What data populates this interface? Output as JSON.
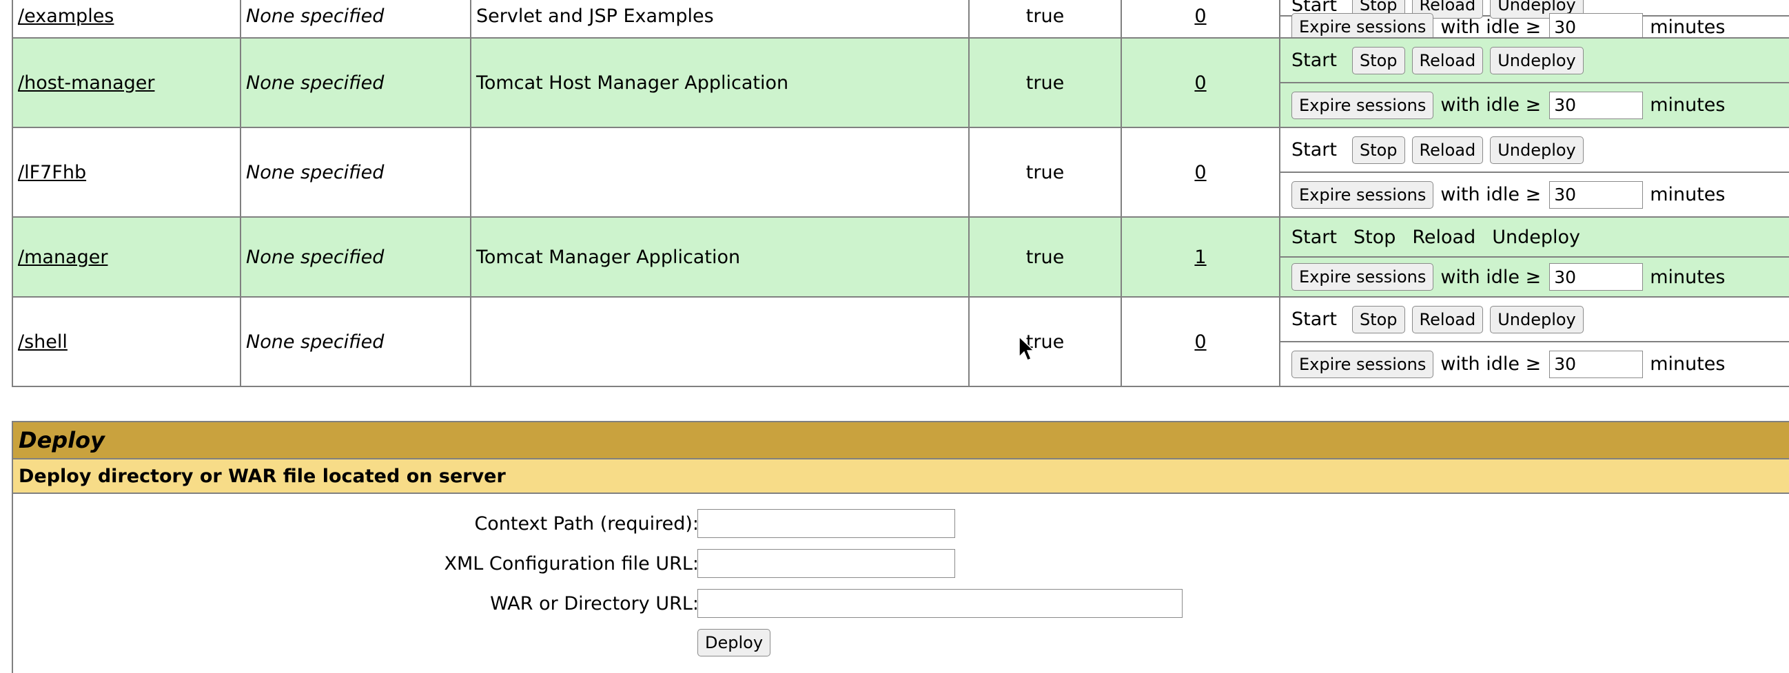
{
  "apps": [
    {
      "path": "/examples",
      "version": "None specified",
      "display": "Servlet and JSP Examples",
      "running": "true",
      "sessions": "0",
      "commands_are_links": false
    },
    {
      "path": "/host-manager",
      "version": "None specified",
      "display": "Tomcat Host Manager Application",
      "running": "true",
      "sessions": "0",
      "commands_are_links": false
    },
    {
      "path": "/lF7Fhb",
      "version": "None specified",
      "display": "",
      "running": "true",
      "sessions": "0",
      "commands_are_links": false
    },
    {
      "path": "/manager",
      "version": "None specified",
      "display": "Tomcat Manager Application",
      "running": "true",
      "sessions": "1",
      "commands_are_links": true
    },
    {
      "path": "/shell",
      "version": "None specified",
      "display": "",
      "running": "true",
      "sessions": "0",
      "commands_are_links": false
    }
  ],
  "commands": {
    "start": "Start",
    "stop": "Stop",
    "reload": "Reload",
    "undeploy": "Undeploy"
  },
  "expire": {
    "button": "Expire sessions",
    "with_idle": "with idle ≥",
    "idle_value": "30",
    "minutes": "minutes"
  },
  "deploy": {
    "title": "Deploy",
    "subtitle": "Deploy directory or WAR file located on server",
    "context_path_label": "Context Path (required):",
    "config_url_label": "XML Configuration file URL:",
    "war_url_label": "WAR or Directory URL:",
    "deploy_button": "Deploy"
  }
}
